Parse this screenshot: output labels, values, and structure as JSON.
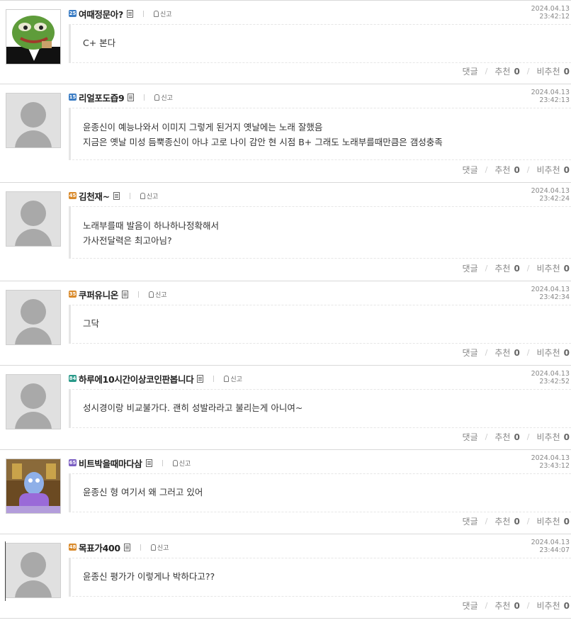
{
  "labels": {
    "report": "신고",
    "reply": "댓글",
    "recommend": "추천",
    "not_recommend": "비추천"
  },
  "colors": {
    "level_blue": "#3a7cc4",
    "level_green": "#5aa83a",
    "level_purple": "#7b5ec2",
    "level_orange": "#d98a2b",
    "level_teal": "#2a9a8a"
  },
  "comments": [
    {
      "level": "25",
      "level_color": "#3a7cc4",
      "avatar": "pepe",
      "nickname": "여때정문아?",
      "date": "2024.04.13",
      "time": "23:42:12",
      "lines": [
        "C+ 본다"
      ],
      "recommend": "0",
      "not_recommend": "0"
    },
    {
      "level": "15",
      "level_color": "#3a7cc4",
      "avatar": "default",
      "nickname": "리얼포도즙9",
      "date": "2024.04.13",
      "time": "23:42:13",
      "lines": [
        "윤종신이 예능나와서 이미지 그렇게 된거지 옛날에는 노래 잘했음",
        "지금은 옛날 미성 듬뿍종신이 아냐 고로 나이 감안 현 시점 B+ 그래도 노래부를때만큼은 갬성충족"
      ],
      "recommend": "0",
      "not_recommend": "0"
    },
    {
      "level": "45",
      "level_color": "#d98a2b",
      "avatar": "default",
      "nickname": "김천재~",
      "date": "2024.04.13",
      "time": "23:42:24",
      "lines": [
        "노래부를때 발음이 하나하나정확해서",
        "가사전달력은 최고아님?"
      ],
      "recommend": "0",
      "not_recommend": "0"
    },
    {
      "level": "35",
      "level_color": "#d98a2b",
      "avatar": "default",
      "nickname": "쿠퍼유니온",
      "date": "2024.04.13",
      "time": "23:42:34",
      "lines": [
        "그닥"
      ],
      "recommend": "0",
      "not_recommend": "0"
    },
    {
      "level": "84",
      "level_color": "#2a9a8a",
      "avatar": "default",
      "nickname": "하루에10시간이상코인판봅니다",
      "date": "2024.04.13",
      "time": "23:42:52",
      "lines": [
        "성시경이랑 비교불가다. 괜히 성발라라고 불리는게 아니여~"
      ],
      "recommend": "0",
      "not_recommend": "0"
    },
    {
      "level": "65",
      "level_color": "#7b5ec2",
      "avatar": "cartoon",
      "nickname": "비트박을때마다삼",
      "date": "2024.04.13",
      "time": "23:43:12",
      "lines": [
        "윤종신 형 여기서 왜 그러고 있어"
      ],
      "recommend": "0",
      "not_recommend": "0"
    },
    {
      "level": "48",
      "level_color": "#d98a2b",
      "avatar": "default",
      "nickname": "목표가400",
      "date": "2024.04.13",
      "time": "23:44:07",
      "lines": [
        "윤종신 평가가 이렇게나 박하다고??"
      ],
      "recommend": "0",
      "not_recommend": "0"
    }
  ]
}
